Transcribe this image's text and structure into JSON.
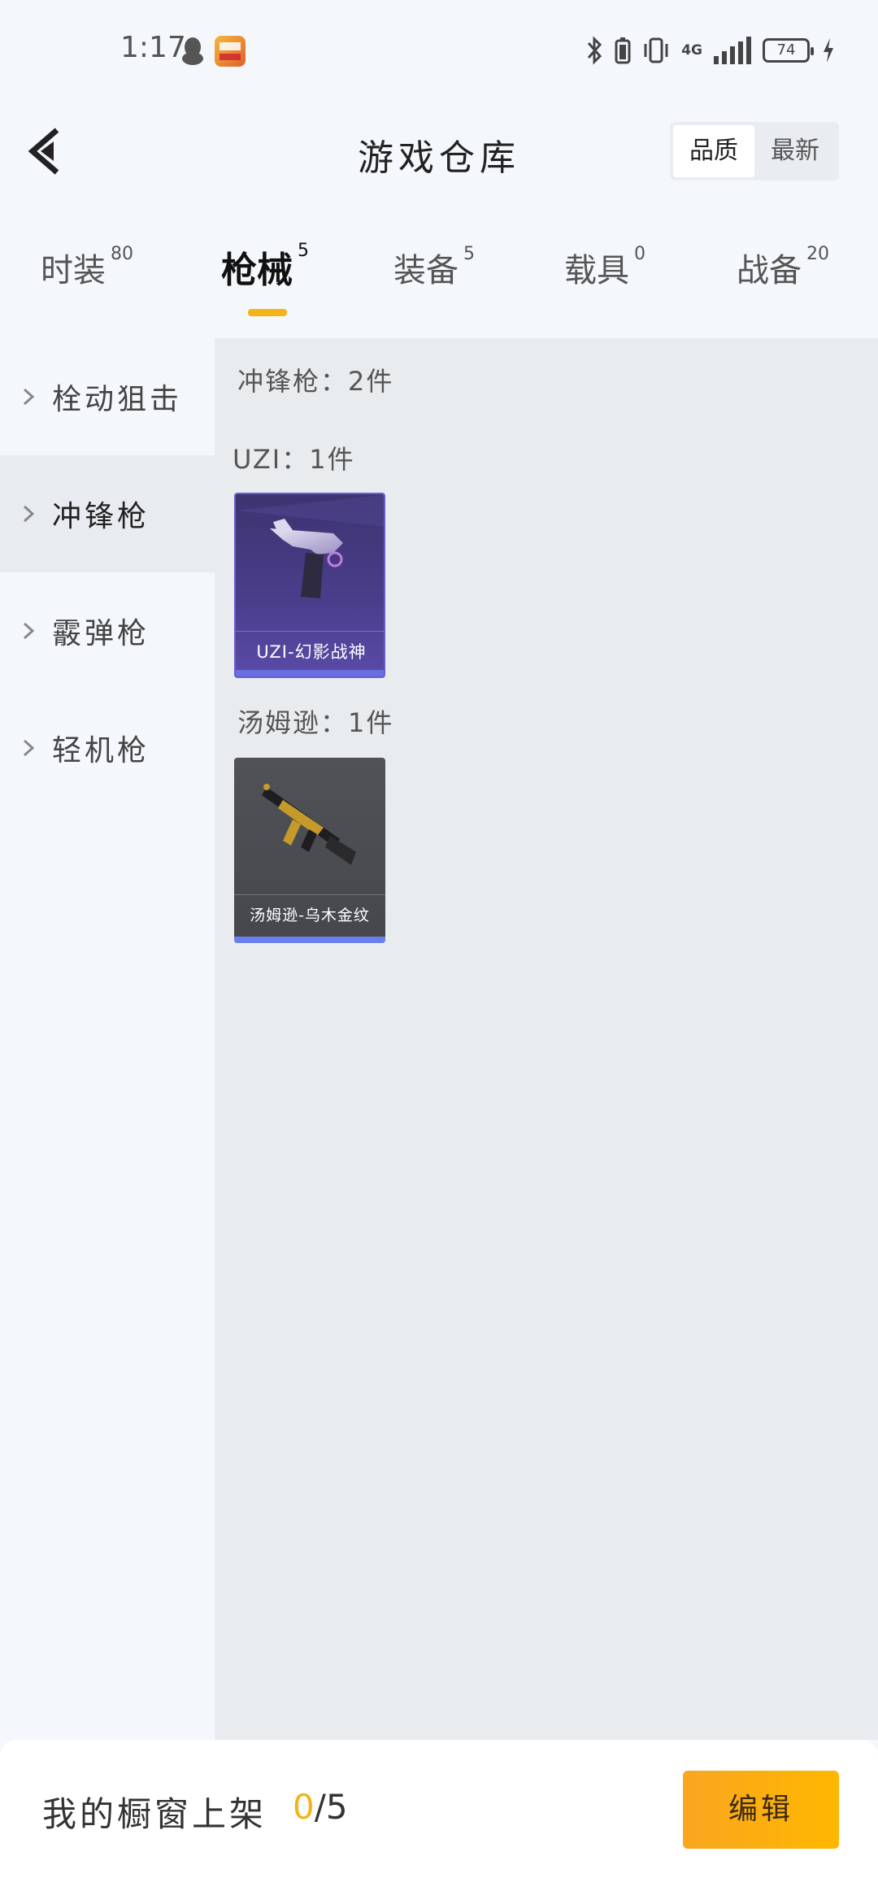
{
  "status_bar": {
    "time": "1:17",
    "network": "4G",
    "battery": "74"
  },
  "header": {
    "title": "游戏仓库",
    "sort_options": [
      "品质",
      "最新"
    ],
    "sort_active": "品质"
  },
  "tabs": [
    {
      "label": "时装",
      "count": "80"
    },
    {
      "label": "枪械",
      "count": "5",
      "active": true
    },
    {
      "label": "装备",
      "count": "5"
    },
    {
      "label": "载具",
      "count": "0"
    },
    {
      "label": "战备",
      "count": "20"
    }
  ],
  "sidebar": {
    "items": [
      {
        "label": "栓动狙击"
      },
      {
        "label": "冲锋枪",
        "active": true
      },
      {
        "label": "霰弹枪"
      },
      {
        "label": "轻机枪"
      }
    ]
  },
  "main": {
    "category_summary": "冲锋枪：2件",
    "groups": [
      {
        "heading": "UZI：1件",
        "items": [
          {
            "name": "UZI-幻影战神",
            "rarity_color": "#6a6fe0"
          }
        ]
      },
      {
        "heading": "汤姆逊：1件",
        "items": [
          {
            "name": "汤姆逊-乌木金纹",
            "rarity_color": "#6a7fe8"
          }
        ]
      }
    ]
  },
  "bottom_bar": {
    "label": "我的橱窗上架",
    "current": "0",
    "total": "/5",
    "edit_label": "编辑"
  },
  "colors": {
    "accent": "#f3b418",
    "edit_button": "#ffb700"
  }
}
